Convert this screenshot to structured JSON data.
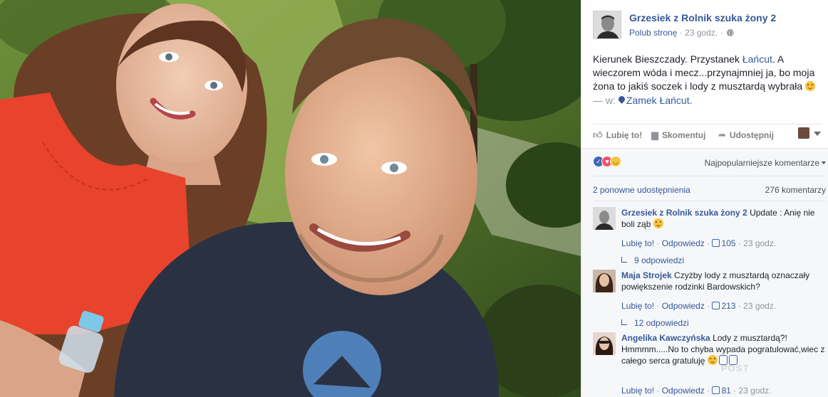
{
  "photo": {
    "description_icon": "selfie-photo",
    "colors": {
      "foliage": "#5f7d34",
      "dress": "#e8432c",
      "tshirt": "#2a3142"
    }
  },
  "post": {
    "page_name": "Grzesiek z Rolnik szuka żony 2",
    "like_page": "Polub stronę",
    "time": "23 godz.",
    "text_before": "Kierunek Bieszczady. Przystanek ",
    "text_link": "Łańcut",
    "text_after": ". A wieczorem wóda i mecz...przynajmniej ja, bo moja żona to jakiś soczek i lody z musztardą wybrała",
    "location_prefix": "— w:",
    "location": "Zamek Łańcut."
  },
  "actions": {
    "like": "Lubię to!",
    "comment": "Skomentuj",
    "share": "Udostępnij"
  },
  "summary": {
    "sort": "Najpopularniejsze komentarze",
    "shares": "2 ponowne udostępnienia",
    "comments": "276 komentarzy"
  },
  "comments": [
    {
      "author": "Grzesiek z Rolnik szuka żony 2",
      "text": "Update : Anię nie boli ząb",
      "like": "Lubię to!",
      "reply": "Odpowiedz",
      "likes": "105",
      "time": "23 godz.",
      "replies": "9 odpowiedzi"
    },
    {
      "author": "Maja Strojek",
      "text": "Czyżby lody z musztardą oznaczały powiększenie rodzinki Bardowskich?",
      "like": "Lubię to!",
      "reply": "Odpowiedz",
      "likes": "213",
      "time": "23 godz.",
      "replies": "12 odpowiedzi"
    },
    {
      "author": "Angelika Kawczyńska",
      "text": "Lody z musztardą?! Hmmmm.....No to chyba wypada pogratulować,wiec z całego serca gratuluję",
      "like": "Lubię to!",
      "reply": "Odpowiedz",
      "likes": "81",
      "time": "23 godz."
    }
  ],
  "watermark": "POST"
}
